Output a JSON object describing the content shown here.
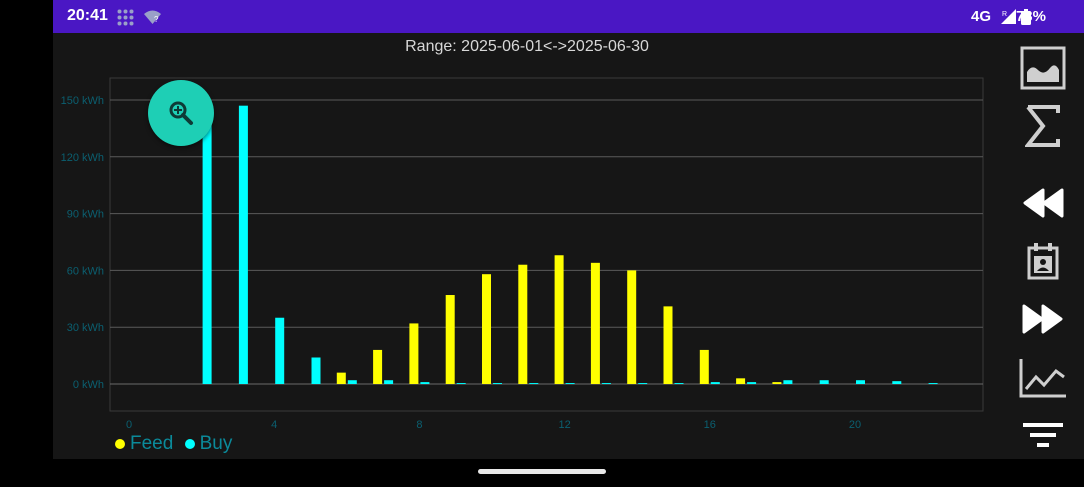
{
  "status": {
    "time": "20:41",
    "network": "4G",
    "battery": "73%"
  },
  "chart_data": {
    "type": "bar",
    "title": "Range: 2025-06-01<->2025-06-30",
    "ylim": [
      0,
      150
    ],
    "y_ticks": [
      "0 kWh",
      "30 kWh",
      "60 kWh",
      "90 kWh",
      "120 kWh",
      "150 kWh"
    ],
    "y_tick_values": [
      0,
      30,
      60,
      90,
      120,
      150
    ],
    "x_ticks": [
      "0",
      "4",
      "8",
      "12",
      "16",
      "20"
    ],
    "x_tick_values": [
      0,
      4,
      8,
      12,
      16,
      20
    ],
    "xlim": [
      0,
      23.5
    ],
    "grid": true,
    "legend_position": "bottom-left",
    "x": [
      0,
      1,
      2,
      3,
      4,
      5,
      6,
      7,
      8,
      9,
      10,
      11,
      12,
      13,
      14,
      15,
      16,
      17,
      18,
      19,
      20,
      21,
      22,
      23
    ],
    "series": [
      {
        "name": "Feed",
        "color": "#ffff00",
        "values": [
          0,
          0,
          0,
          0,
          0,
          0,
          6,
          18,
          32,
          47,
          58,
          63,
          68,
          64,
          60,
          41,
          18,
          3,
          1,
          0,
          0,
          0,
          0,
          0
        ]
      },
      {
        "name": "Buy",
        "color": "#00ffff",
        "values": [
          0,
          0,
          137,
          147,
          35,
          14,
          2,
          2,
          1,
          0.5,
          0.5,
          0.5,
          0.5,
          0.5,
          0.5,
          0.5,
          1,
          1,
          2,
          2,
          2,
          1.5,
          0.5,
          0
        ]
      }
    ]
  },
  "colors": {
    "status_bar": "#4a17c4",
    "fab": "#1ecfb5",
    "background": "#161616",
    "axis_text": "#0b5f70"
  },
  "sidebar": {
    "buttons": [
      {
        "icon": "image-chart-icon"
      },
      {
        "icon": "sigma-icon"
      },
      {
        "icon": "rewind-icon"
      },
      {
        "icon": "calendar-icon"
      },
      {
        "icon": "fast-forward-icon"
      },
      {
        "icon": "trend-chart-icon"
      },
      {
        "icon": "filter-icon"
      }
    ]
  }
}
